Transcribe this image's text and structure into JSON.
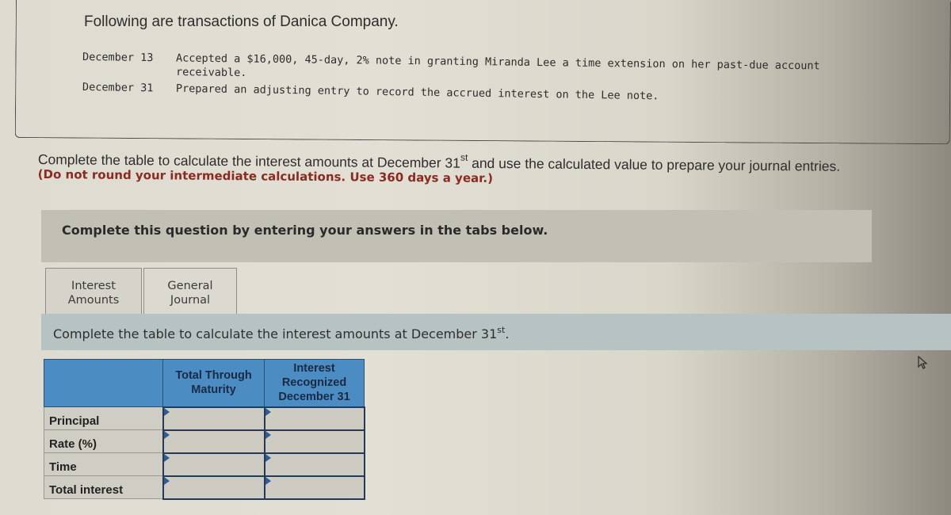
{
  "problem": {
    "intro": "Following are transactions of Danica Company.",
    "transactions": [
      {
        "date": "December 13",
        "description": "Accepted a $16,000, 45-day, 2% note in granting Miranda Lee a time extension on her past-due account",
        "description_cont": "receivable."
      },
      {
        "date": "December 31",
        "description": "Prepared an adjusting entry to record the accrued interest on the Lee note."
      }
    ]
  },
  "instructions": {
    "main_before_sup": "Complete the table to calculate the interest amounts at December 31",
    "main_sup": "st",
    "main_after_sup": " and use the calculated value to prepare your journal entries.",
    "note": "(Do not round your intermediate calculations. Use 360 days a year.)"
  },
  "banner": {
    "text": "Complete this question by entering your answers in the tabs below."
  },
  "tabs": [
    {
      "label_line1": "Interest",
      "label_line2": "Amounts",
      "active": true
    },
    {
      "label_line1": "General",
      "label_line2": "Journal",
      "active": false
    }
  ],
  "subbanner": {
    "text_before_sup": "Complete the table to calculate the interest amounts at December 31",
    "text_sup": "st",
    "text_after_sup": "."
  },
  "table": {
    "headers": [
      "",
      "Total Through Maturity",
      "Interest Recognized December 31"
    ],
    "header_col1_line1": "Total Through",
    "header_col1_line2": "Maturity",
    "header_col2_line1": "Interest",
    "header_col2_line2": "Recognized",
    "header_col2_line3": "December 31",
    "rows": [
      {
        "label": "Principal",
        "total_through_maturity": "",
        "interest_recognized_dec31": ""
      },
      {
        "label": "Rate (%)",
        "total_through_maturity": "",
        "interest_recognized_dec31": ""
      },
      {
        "label": "Time",
        "total_through_maturity": "",
        "interest_recognized_dec31": ""
      },
      {
        "label": "Total interest",
        "total_through_maturity": "",
        "interest_recognized_dec31": ""
      }
    ]
  },
  "colors": {
    "table_header": "#4b8cc3",
    "note_text": "#8a2a22",
    "banner_bg": "#c2c0b4",
    "subbanner_bg": "#b7c3c3"
  },
  "icons": {
    "cursor": "mouse-pointer-icon",
    "cell_flag": "input-flag-icon"
  }
}
